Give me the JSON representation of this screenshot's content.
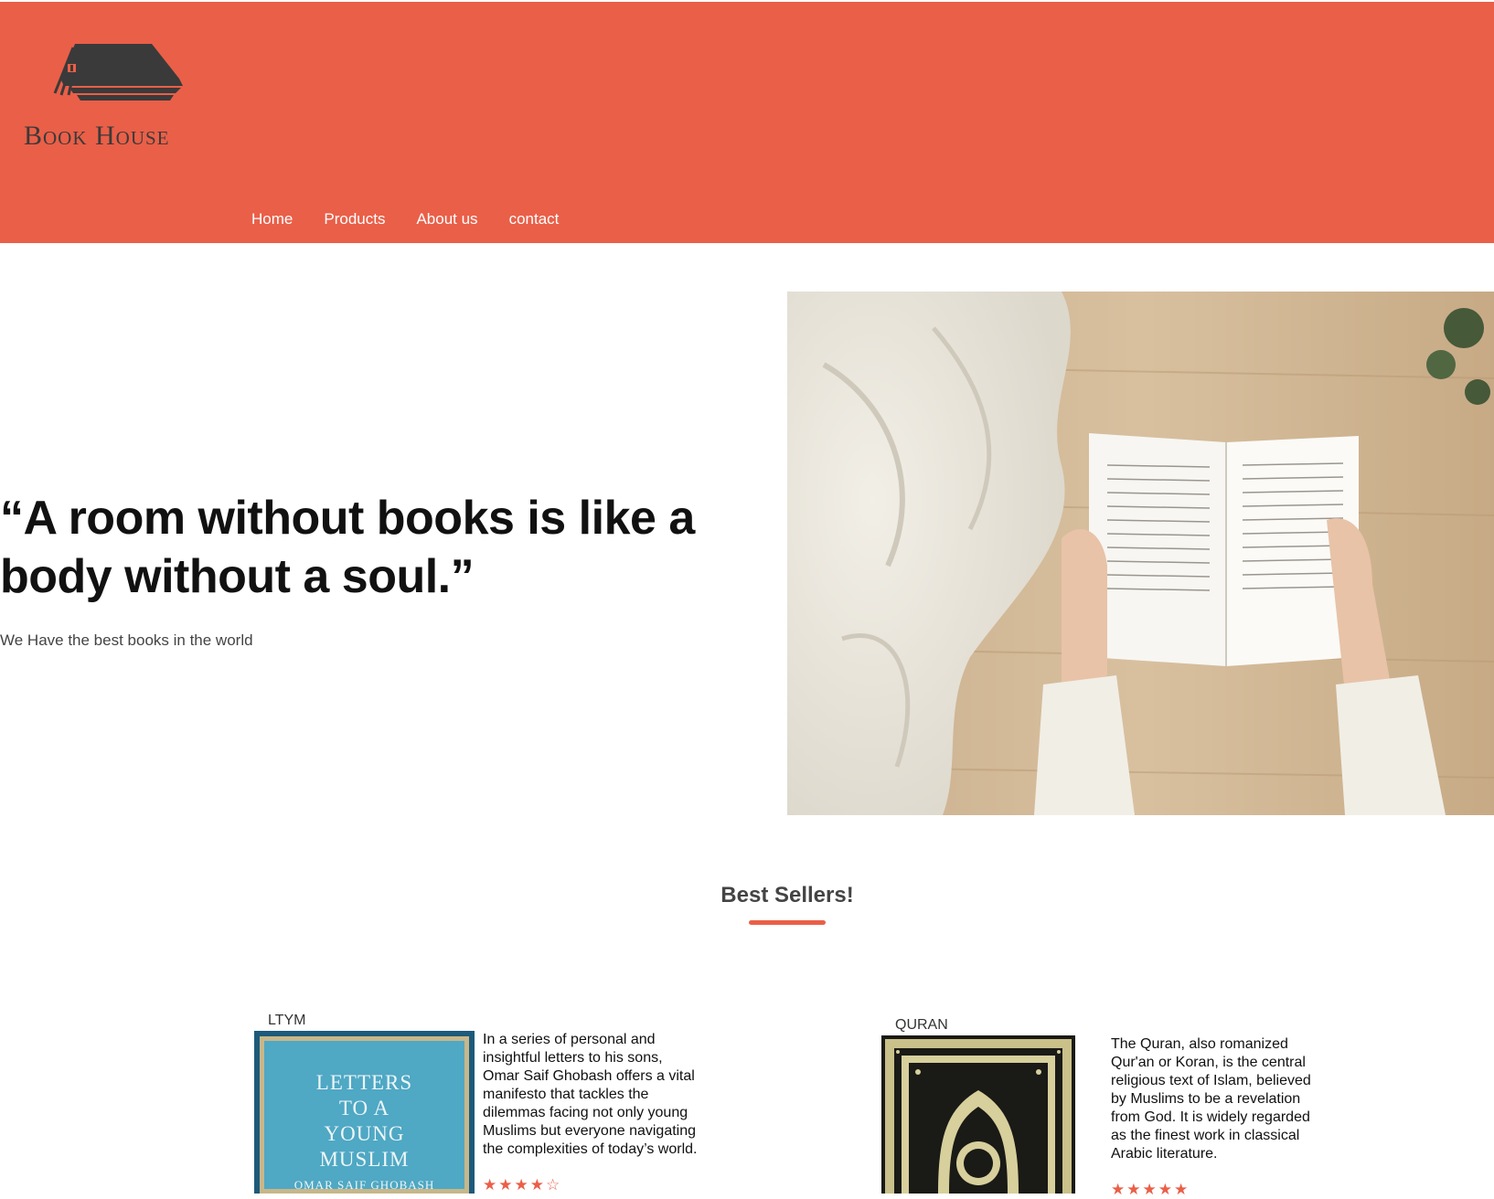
{
  "brand": {
    "name": "Book House"
  },
  "nav": {
    "items": [
      {
        "label": "Home"
      },
      {
        "label": "Products"
      },
      {
        "label": "About us"
      },
      {
        "label": "contact"
      }
    ]
  },
  "hero": {
    "quote": "“A room without books is like a body without a soul.”",
    "tagline": "We Have the best books in the world",
    "image_icon": "open-book-photo"
  },
  "bestsellers": {
    "title": "Best Sellers!",
    "products": [
      {
        "label": "LTYM",
        "cover_title_lines": [
          "LETTERS",
          "TO A",
          "YOUNG",
          "MUSLIM"
        ],
        "cover_author": "OMAR SAIF GHOBASH",
        "description": "In a series of personal and insightful letters to his sons, Omar Saif Ghobash offers a vital manifesto that tackles the dilemmas facing not only young Muslims but everyone navigating the complexities of today’s world.",
        "stars": "★★★★☆",
        "rating": 4
      },
      {
        "label": "QURAN",
        "description": "The Quran, also romanized Qur'an or Koran, is the central religious text of Islam, believed by Muslims to be a revelation from God. It is widely regarded as the finest work in classical Arabic literature.",
        "stars": "★★★★★",
        "rating": 5
      }
    ]
  },
  "colors": {
    "accent": "#ea5f48",
    "logo": "#3a3a3a"
  }
}
